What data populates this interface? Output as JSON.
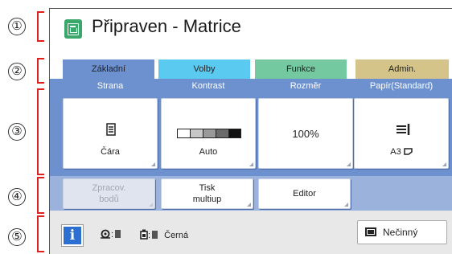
{
  "callouts": [
    "①",
    "②",
    "③",
    "④",
    "⑤"
  ],
  "header": {
    "icon": "stencil-master-icon",
    "title": "Připraven - Matrice"
  },
  "tabs": [
    {
      "label": "Základní",
      "color": "#6d91cf",
      "active": true
    },
    {
      "label": "Volby",
      "color": "#5bcaf1",
      "active": false
    },
    {
      "label": "Funkce",
      "color": "#74c9a1",
      "active": false
    },
    {
      "label": "Admin.",
      "color": "#d4c48a",
      "active": false
    }
  ],
  "settings": [
    {
      "header": "Strana",
      "icon": "document-icon",
      "value": "Čára"
    },
    {
      "header": "Kontrast",
      "icon": "contrast-scale-icon",
      "value": "Auto"
    },
    {
      "header": "Rozměr",
      "icon": "",
      "value": "100%"
    },
    {
      "header": "Papír(Standard)",
      "icon": "paper-tray-icon",
      "value": "A3"
    }
  ],
  "functions": [
    {
      "label_line1": "Zpracov.",
      "label_line2": "bodů",
      "enabled": false
    },
    {
      "label_line1": "Tisk",
      "label_line2": "multiup",
      "enabled": true
    },
    {
      "label_line1": "Editor",
      "label_line2": "",
      "enabled": true
    }
  ],
  "status": {
    "info_label": "i",
    "drum_icon": "drum-icon",
    "ink_icon": "ink-cartridge-icon",
    "ink_color": "Černá",
    "idle_label": "Nečinný",
    "idle_icon": "monitor-icon"
  },
  "colors": {
    "panel_blue": "#6d91cf",
    "function_row": "#9bb2dd",
    "accent_green": "#3aa86a",
    "info_blue": "#2c6fd1",
    "callout_red": "#dd2222"
  }
}
